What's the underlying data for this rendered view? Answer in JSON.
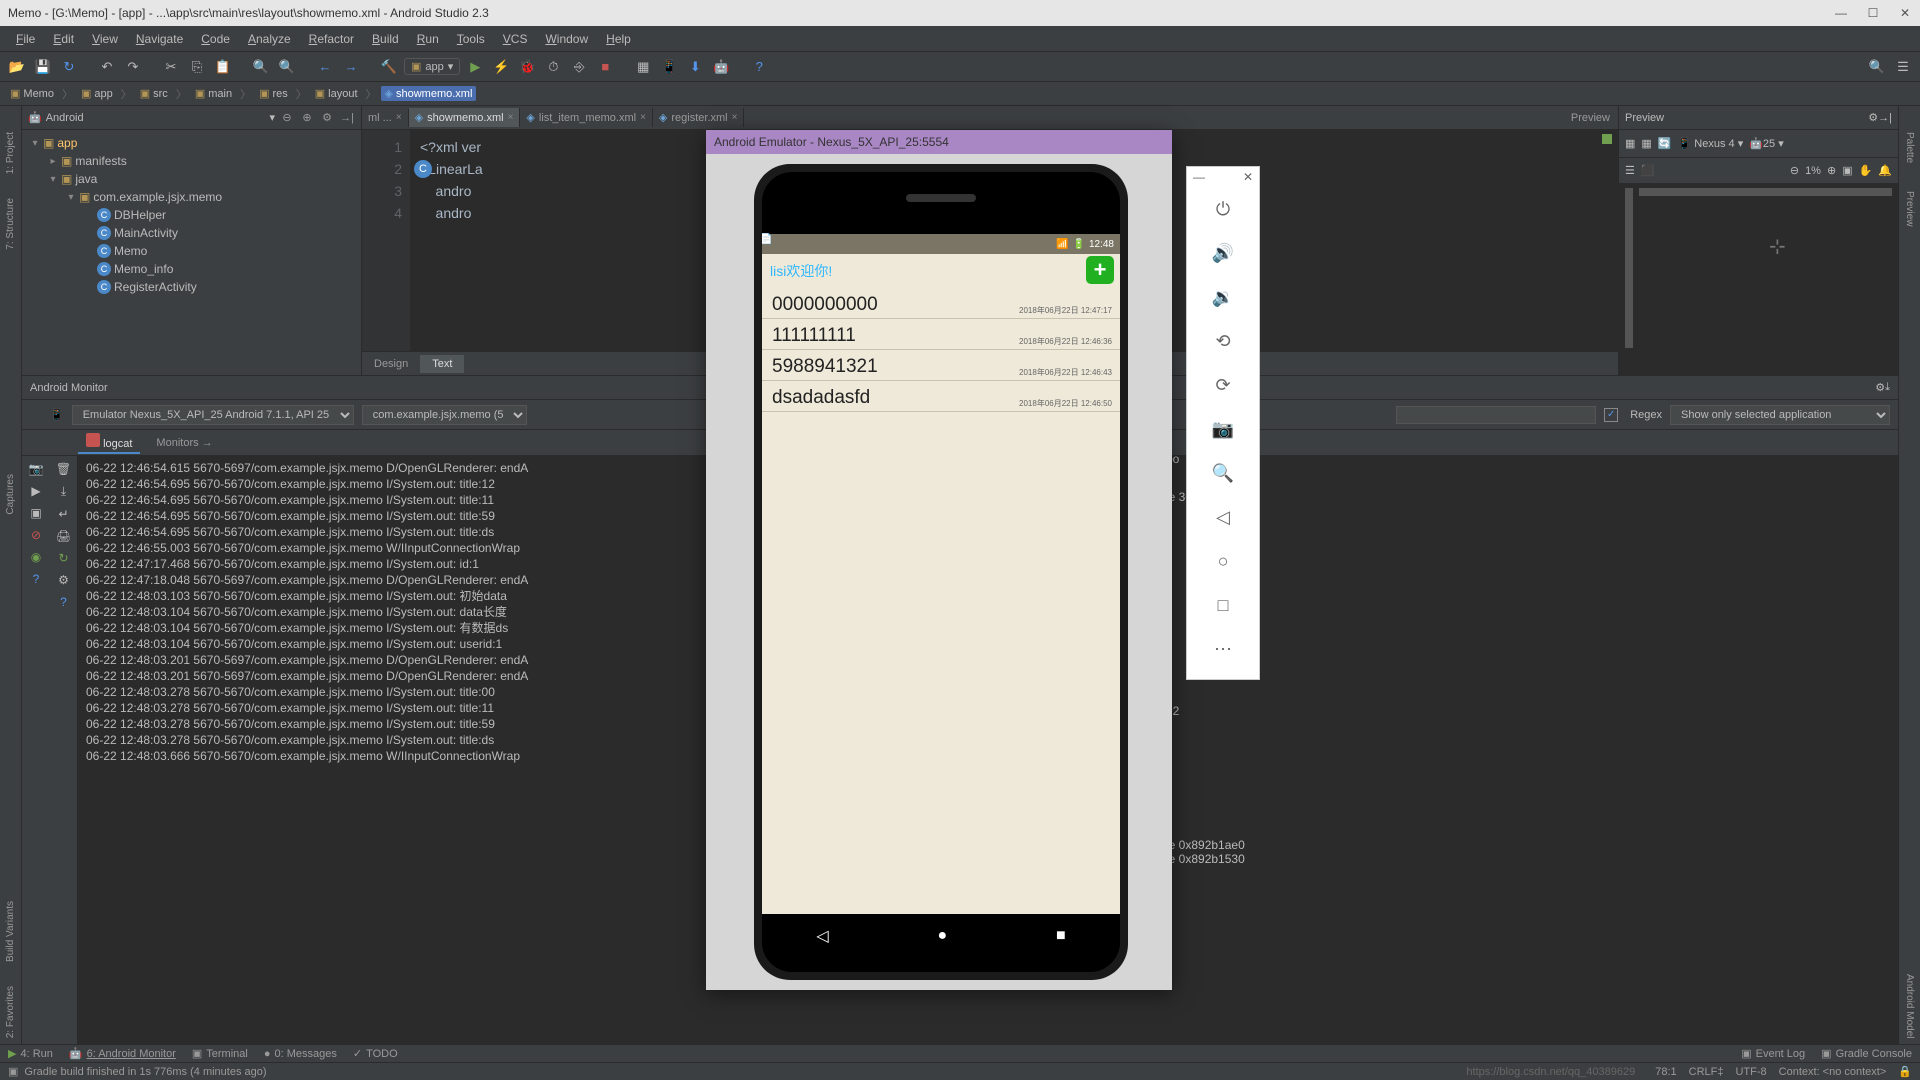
{
  "title": "Memo - [G:\\Memo] - [app] - ...\\app\\src\\main\\res\\layout\\showmemo.xml - Android Studio 2.3",
  "menus": [
    "File",
    "Edit",
    "View",
    "Navigate",
    "Code",
    "Analyze",
    "Refactor",
    "Build",
    "Run",
    "Tools",
    "VCS",
    "Window",
    "Help"
  ],
  "app_selector": "app",
  "crumbs": [
    {
      "icon": "fold",
      "label": "Memo"
    },
    {
      "icon": "fold",
      "label": "app"
    },
    {
      "icon": "fold",
      "label": "src"
    },
    {
      "icon": "fold",
      "label": "main"
    },
    {
      "icon": "fold",
      "label": "res"
    },
    {
      "icon": "fold",
      "label": "layout"
    },
    {
      "icon": "xml",
      "label": "showmemo.xml",
      "sel": true
    }
  ],
  "side_left": [
    "1: Project",
    "7: Structure",
    "Captures"
  ],
  "side_right": [
    "Palette",
    "Preview",
    "Android Model"
  ],
  "projhead": "Android",
  "tree": [
    {
      "ind": 0,
      "t": "▾",
      "ic": "fold",
      "bold": true,
      "label": "app"
    },
    {
      "ind": 1,
      "t": "▸",
      "ic": "fold",
      "label": "manifests"
    },
    {
      "ind": 1,
      "t": "▾",
      "ic": "fold",
      "label": "java"
    },
    {
      "ind": 2,
      "t": "▾",
      "ic": "fold",
      "label": "com.example.jsjx.memo"
    },
    {
      "ind": 3,
      "t": "",
      "ic": "cls",
      "label": "DBHelper"
    },
    {
      "ind": 3,
      "t": "",
      "ic": "cls",
      "label": "MainActivity"
    },
    {
      "ind": 3,
      "t": "",
      "ic": "cls",
      "label": "Memo"
    },
    {
      "ind": 3,
      "t": "",
      "ic": "cls",
      "label": "Memo_info"
    },
    {
      "ind": 3,
      "t": "",
      "ic": "cls",
      "label": "RegisterActivity"
    }
  ],
  "tabs": [
    {
      "ic": "",
      "label": "ml ...",
      "x": "×"
    },
    {
      "ic": "xml",
      "label": "showmemo.xml",
      "x": "×",
      "act": true
    },
    {
      "ic": "xml",
      "label": "list_item_memo.xml",
      "x": "×"
    },
    {
      "ic": "xml",
      "label": "register.xml",
      "x": "×"
    }
  ],
  "code": {
    "lines": [
      "1",
      "2",
      "3",
      "4"
    ],
    "text": [
      "<?xml ver",
      "<LinearLa                                                                  .com/apk/res/android\"",
      "    andro",
      "    andro"
    ]
  },
  "ed_bottom": [
    "Design",
    "Text"
  ],
  "preview_head": "Preview",
  "preview_device": "Nexus 4",
  "preview_api": "25",
  "preview_zoom": "1%",
  "monitor_head": "Android Monitor",
  "dev_sel": "Emulator Nexus_5X_API_25 Android 7.1.1, API 25",
  "pkg_sel": "com.example.jsjx.memo (5",
  "search_ph": "",
  "regex": "Regex",
  "filter_sel": "Show only selected application",
  "mon_tabs": [
    "logcat",
    "Monitors →"
  ],
  "log": [
    "06-22 12:46:54.615 5670-5697/com.example.jsjx.memo D/OpenGLRenderer: endA",
    "06-22 12:46:54.695 5670-5670/com.example.jsjx.memo I/System.out: title:12",
    "06-22 12:46:54.695 5670-5670/com.example.jsjx.memo I/System.out: title:11",
    "06-22 12:46:54.695 5670-5670/com.example.jsjx.memo I/System.out: title:59",
    "06-22 12:46:54.695 5670-5670/com.example.jsjx.memo I/System.out: title:ds",
    "06-22 12:46:55.003 5670-5670/com.example.jsjx.memo W/IInputConnectionWrap",
    "06-22 12:47:17.468 5670-5670/com.example.jsjx.memo I/System.out: id:1",
    "06-22 12:47:18.048 5670-5697/com.example.jsjx.memo D/OpenGLRenderer: endA",
    "06-22 12:48:03.103 5670-5670/com.example.jsjx.memo I/System.out: 初始data",
    "06-22 12:48:03.104 5670-5670/com.example.jsjx.memo I/System.out: data长度",
    "06-22 12:48:03.104 5670-5670/com.example.jsjx.memo I/System.out: 有数据ds",
    "06-22 12:48:03.104 5670-5670/com.example.jsjx.memo I/System.out: userid:1",
    "06-22 12:48:03.201 5670-5697/com.example.jsjx.memo D/OpenGLRenderer: endA",
    "06-22 12:48:03.201 5670-5697/com.example.jsjx.memo D/OpenGLRenderer: endA",
    "06-22 12:48:03.278 5670-5670/com.example.jsjx.memo I/System.out: title:00",
    "06-22 12:48:03.278 5670-5670/com.example.jsjx.memo I/System.out: title:11",
    "06-22 12:48:03.278 5670-5670/com.example.jsjx.memo I/System.out: title:59",
    "06-22 12:48:03.278 5670-5670/com.example.jsjx.memo I/System.out: title:ds",
    "06-22 12:48:03.666 5670-5670/com.example.jsjx.memo W/IInputConnectionWrap"
  ],
  "log_extra": {
    "l1": "bo",
    "l2": "le                30",
    "l3": "92",
    "l4": "le 0x892b1ae0",
    "l5": "le 0x892b1530"
  },
  "btm": [
    {
      "ic": "▶",
      "c": "#6f9f4f",
      "label": "4: Run"
    },
    {
      "ic": "🤖",
      "c": "#6f9f4f",
      "label": "6: Android Monitor",
      "u": true
    },
    {
      "ic": "▣",
      "c": "#999",
      "label": "Terminal"
    },
    {
      "ic": "●",
      "c": "#999",
      "label": "0: Messages"
    },
    {
      "ic": "✓",
      "c": "#999",
      "label": "TODO"
    }
  ],
  "btm_r": [
    "Event Log",
    "Gradle Console"
  ],
  "status": "Gradle build finished in 1s 776ms (4 minutes ago)",
  "status_r": [
    "78:1",
    "CRLF‡",
    "UTF-8",
    "Context: <no context>"
  ],
  "watermark": "https://blog.csdn.net/qq_40389629",
  "emu": {
    "title": "Android Emulator - Nexus_5X_API_25:5554",
    "time": "12:48",
    "welcome": "lisi欢迎你!",
    "memos": [
      {
        "t": "0000000000",
        "d": "2018年06月22日  12:47:17"
      },
      {
        "t": "111111111",
        "d": "2018年06月22日  12:46:36"
      },
      {
        "t": "5988941321",
        "d": "2018年06月22日  12:46:43"
      },
      {
        "t": "dsadadasfd",
        "d": "2018年06月22日  12:46:50"
      }
    ]
  }
}
